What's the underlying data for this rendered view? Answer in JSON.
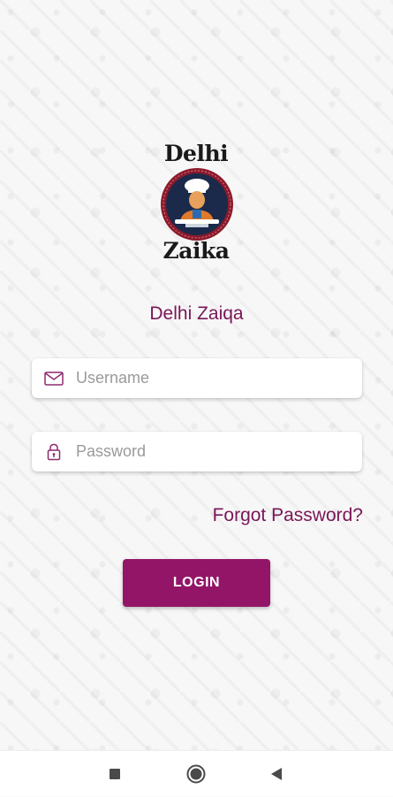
{
  "logo": {
    "word_top": "Delhi",
    "word_bottom": "Zaika"
  },
  "app_name": "Delhi Zaiqa",
  "username": {
    "placeholder": "Username",
    "value": "",
    "icon": "mail-icon"
  },
  "password": {
    "placeholder": "Password",
    "value": "",
    "icon": "lock-icon"
  },
  "forgot_password_label": "Forgot Password?",
  "login_label": "LOGIN",
  "colors": {
    "accent": "#931568",
    "text_accent": "#7a1658",
    "badge_ring": "#8b1a2b",
    "badge_fill": "#1b2a4a"
  },
  "navbar": {
    "recent_icon": "square-icon",
    "home_icon": "circle-icon",
    "back_icon": "triangle-back-icon"
  }
}
